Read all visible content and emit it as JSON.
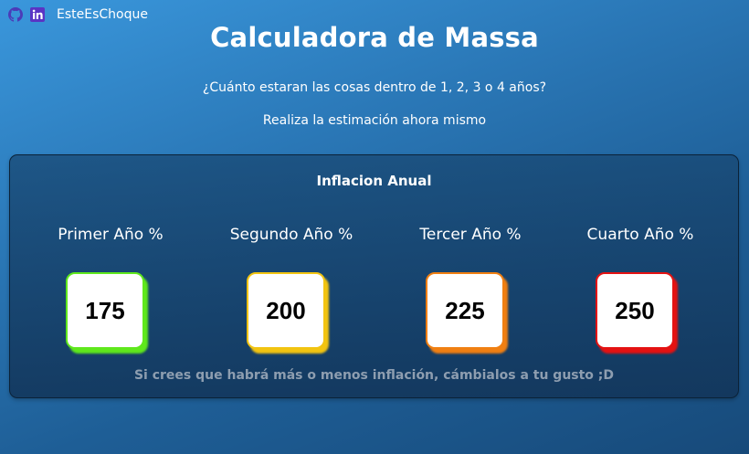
{
  "header": {
    "brand": "EsteEsChoque",
    "icons": [
      "github-icon",
      "linkedin-icon"
    ],
    "linkedin_color": "#6a3cc7"
  },
  "hero": {
    "title": "Calculadora de Massa",
    "question": "¿Cuánto estaran las cosas dentro de 1, 2, 3 o 4 años?",
    "cta": "Realiza la estimación ahora mismo"
  },
  "panel": {
    "title": "Inflacion Anual",
    "years": [
      {
        "label": "Primer Año %",
        "value": "175",
        "color": "#5fe81c"
      },
      {
        "label": "Segundo Año %",
        "value": "200",
        "color": "#f2c411"
      },
      {
        "label": "Tercer Año %",
        "value": "225",
        "color": "#f07f12"
      },
      {
        "label": "Cuarto Año %",
        "value": "250",
        "color": "#e41212"
      }
    ],
    "footnote": "Si crees que habrá más o menos inflación, cámbialos a tu gusto ;D"
  }
}
